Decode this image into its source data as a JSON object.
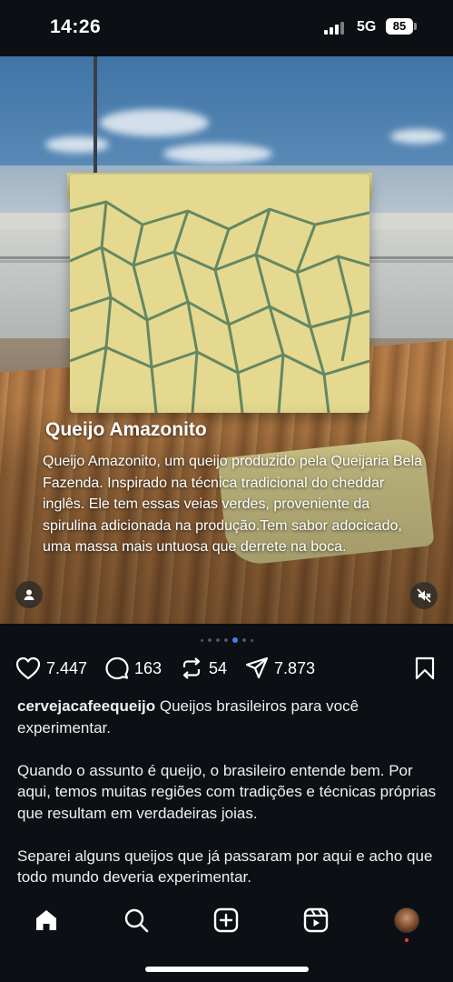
{
  "status_bar": {
    "time": "14:26",
    "network": "5G",
    "battery": "85"
  },
  "post": {
    "caption_title": "Queijo Amazonito",
    "caption_body": "Queijo Amazonito, um queijo produzido pela Queijaria Bela Fazenda. Inspirado na técnica tradicional do cheddar inglês. Ele tem essas veias verdes, proveniente da spirulina adicionada na produção.Tem sabor adocicado, uma massa mais untuosa que derrete na boca.",
    "carousel": {
      "total": 7,
      "active_index": 4
    },
    "likes": "7.447",
    "comments": "163",
    "reposts": "54",
    "shares": "7.873",
    "username": "cervejacafeequeijo",
    "description_first": " Queijos brasileiros para você experimentar.",
    "paragraph_2": "Quando o assunto é queijo, o brasileiro entende bem. Por aqui, temos muitas regiões com tradições e técnicas próprias que resultam em verdadeiras joias.",
    "paragraph_3": "Separei alguns queijos que já passaram por aqui e acho que todo mundo deveria experimentar."
  },
  "icons": {
    "like": "heart-icon",
    "comment": "comment-icon",
    "repost": "repost-icon",
    "share": "send-icon",
    "save": "bookmark-icon",
    "nav": [
      "home-icon",
      "search-icon",
      "create-icon",
      "reels-icon",
      "profile-avatar"
    ]
  },
  "colors": {
    "background": "#0c0f14",
    "active_dot": "#3b82f6",
    "notification": "#ff3040"
  }
}
